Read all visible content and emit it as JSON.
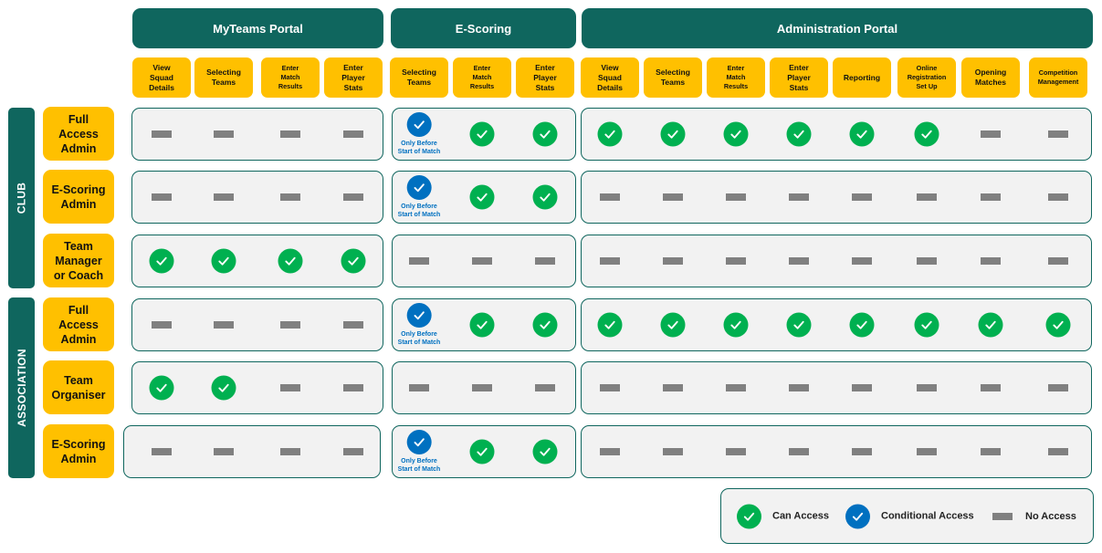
{
  "colors": {
    "header_teal": "#0f665e",
    "column_yellow": "#ffc000",
    "can_access_green": "#00b050",
    "conditional_blue": "#0070c0",
    "no_access_gray": "#808080",
    "cell_background": "#f2f2f2"
  },
  "portals": [
    {
      "name": "MyTeams Portal",
      "columns": [
        "View\nSquad\nDetails",
        "Selecting\nTeams",
        "Enter\nMatch\nResults",
        "Enter\nPlayer\nStats"
      ]
    },
    {
      "name": "E-Scoring",
      "columns": [
        "Selecting\nTeams",
        "Enter\nMatch\nResults",
        "Enter\nPlayer\nStats"
      ]
    },
    {
      "name": "Administration Portal",
      "columns": [
        "View\nSquad\nDetails",
        "Selecting\nTeams",
        "Enter\nMatch\nResults",
        "Enter\nPlayer\nStats",
        "Reporting",
        "Online\nRegistration\nSet Up",
        "Opening\nMatches",
        "Competition\nManagement"
      ]
    }
  ],
  "groups": [
    {
      "name": "CLUB",
      "roles": [
        "Full\nAccess\nAdmin",
        "E-Scoring\nAdmin",
        "Team\nManager\nor Coach"
      ]
    },
    {
      "name": "ASSOCIATION",
      "roles": [
        "Full\nAccess\nAdmin",
        "Team\nOrganiser",
        "E-Scoring\nAdmin"
      ]
    }
  ],
  "conditional_note": "Only Before\nStart of Match",
  "matrix": [
    {
      "group": "CLUB",
      "role": "Full Access Admin",
      "myteams": [
        "no",
        "no",
        "no",
        "no"
      ],
      "escoring": [
        "conditional",
        "yes",
        "yes"
      ],
      "admin": [
        "yes",
        "yes",
        "yes",
        "yes",
        "yes",
        "yes",
        "no",
        "no"
      ]
    },
    {
      "group": "CLUB",
      "role": "E-Scoring Admin",
      "myteams": [
        "no",
        "no",
        "no",
        "no"
      ],
      "escoring": [
        "conditional",
        "yes",
        "yes"
      ],
      "admin": [
        "no",
        "no",
        "no",
        "no",
        "no",
        "no",
        "no",
        "no"
      ]
    },
    {
      "group": "CLUB",
      "role": "Team Manager or Coach",
      "myteams": [
        "yes",
        "yes",
        "yes",
        "yes"
      ],
      "escoring": [
        "no",
        "no",
        "no"
      ],
      "admin": [
        "no",
        "no",
        "no",
        "no",
        "no",
        "no",
        "no",
        "no"
      ]
    },
    {
      "group": "ASSOCIATION",
      "role": "Full Access Admin",
      "myteams": [
        "no",
        "no",
        "no",
        "no"
      ],
      "escoring": [
        "conditional",
        "yes",
        "yes"
      ],
      "admin": [
        "yes",
        "yes",
        "yes",
        "yes",
        "yes",
        "yes",
        "yes",
        "yes"
      ]
    },
    {
      "group": "ASSOCIATION",
      "role": "Team Organiser",
      "myteams": [
        "yes",
        "yes",
        "no",
        "no"
      ],
      "escoring": [
        "no",
        "no",
        "no"
      ],
      "admin": [
        "no",
        "no",
        "no",
        "no",
        "no",
        "no",
        "no",
        "no"
      ]
    },
    {
      "group": "ASSOCIATION",
      "role": "E-Scoring Admin",
      "myteams": [
        "no",
        "no",
        "no",
        "no"
      ],
      "escoring": [
        "conditional",
        "yes",
        "yes"
      ],
      "admin": [
        "no",
        "no",
        "no",
        "no",
        "no",
        "no",
        "no",
        "no"
      ]
    }
  ],
  "legend": [
    {
      "type": "yes",
      "label": "Can Access"
    },
    {
      "type": "conditional",
      "label": "Conditional Access"
    },
    {
      "type": "no",
      "label": "No Access"
    }
  ]
}
